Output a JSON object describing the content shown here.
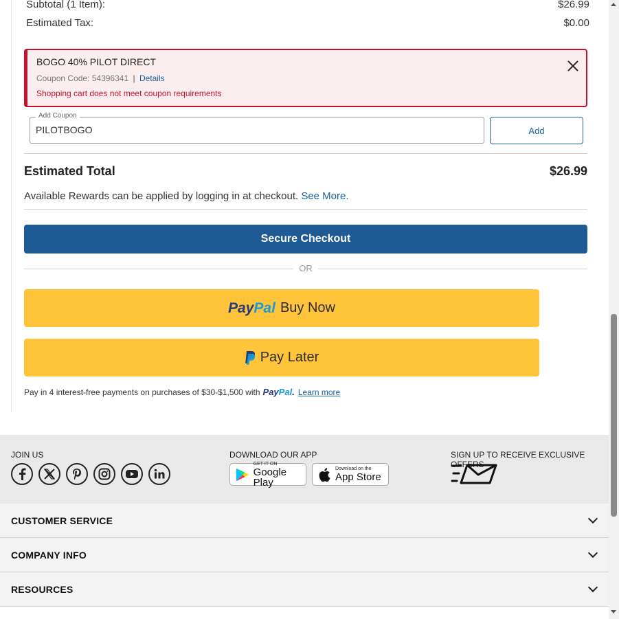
{
  "summary": {
    "subtotal_label": "Subtotal (1 Item):",
    "subtotal_value": "$26.99",
    "tax_label": "Estimated Tax:",
    "tax_value": "$0.00"
  },
  "coupon_applied": {
    "title": "BOGO 40% PILOT DIRECT",
    "code_label": "Coupon Code: 54396341",
    "separator": "|",
    "details_link": "Details",
    "error": "Shopping cart does not meet coupon requirements",
    "error_color": "#c8102e"
  },
  "coupon_input": {
    "label": "Add Coupon",
    "value": "PILOTBOGO",
    "add_label": "Add"
  },
  "total": {
    "label": "Estimated Total",
    "value": "$26.99"
  },
  "rewards": {
    "text": "Available Rewards can be applied by logging in at checkout.",
    "link": "See More."
  },
  "checkout": {
    "label": "Secure Checkout",
    "color": "#1d5a96"
  },
  "or_text": "OR",
  "paypal": {
    "brand_pay": "Pay",
    "brand_pal": "Pal",
    "buy_now_label": "Buy Now",
    "pay_later_label": "Pay Later",
    "button_color": "#ffc439",
    "info_text": "Pay in 4 interest-free payments on purchases of $30-$1,500 with",
    "info_suffix": ".",
    "learn_more": "Learn more"
  },
  "footer": {
    "join_us": "JOIN US",
    "social_icons": [
      "facebook-icon",
      "x-icon",
      "pinterest-icon",
      "instagram-icon",
      "youtube-icon",
      "linkedin-icon"
    ],
    "download_app": "DOWNLOAD OUR APP",
    "google_play_small": "GET IT ON",
    "google_play_big": "Google Play",
    "app_store_small": "Download on the",
    "app_store_big": "App Store",
    "sign_up": "SIGN UP TO RECEIVE EXCLUSIVE OFFERS",
    "accordions": [
      "CUSTOMER SERVICE",
      "COMPANY INFO",
      "RESOURCES"
    ]
  }
}
